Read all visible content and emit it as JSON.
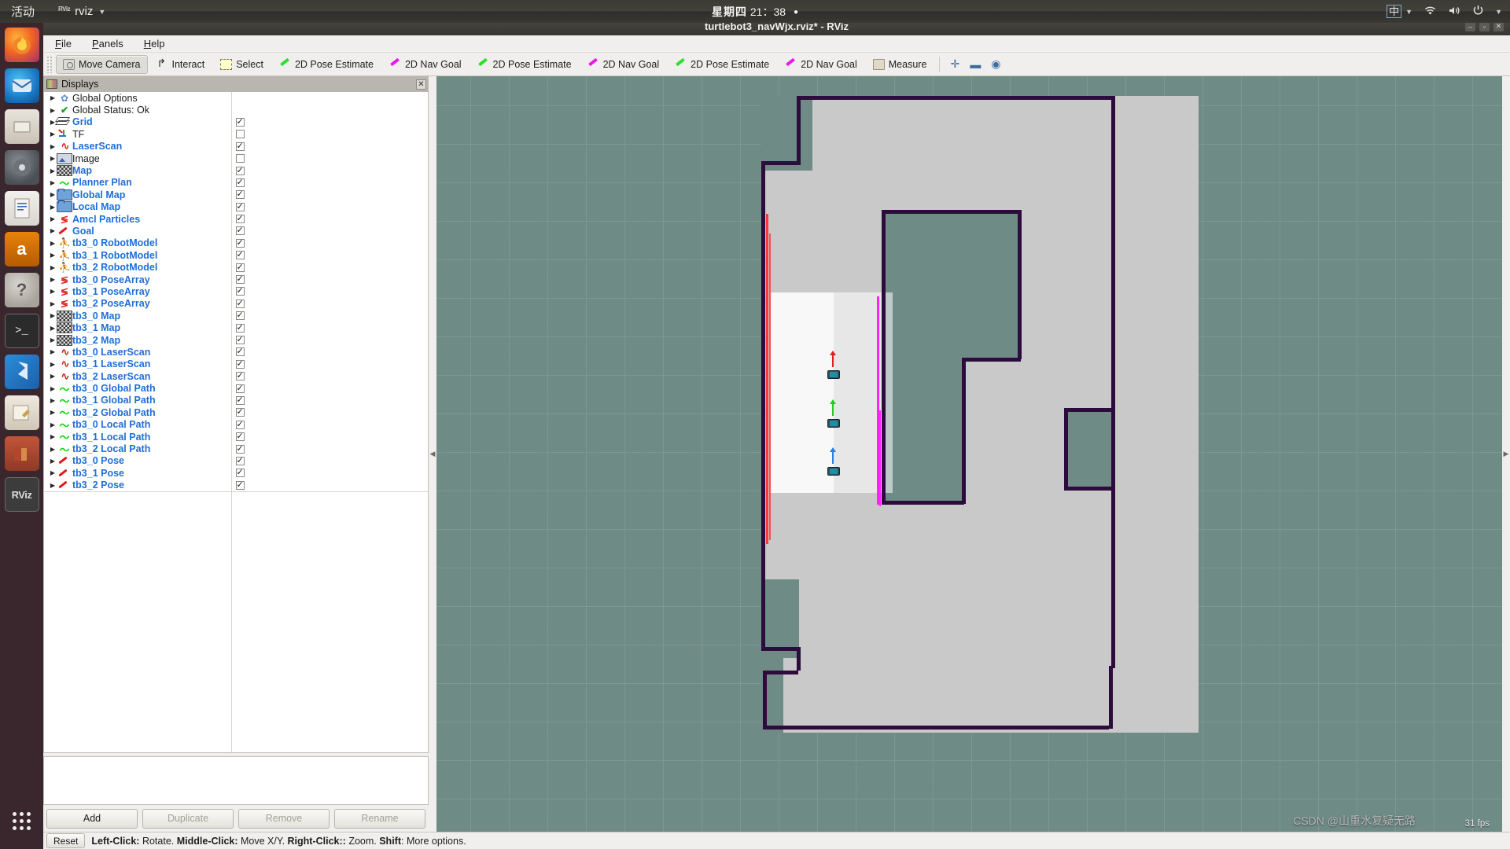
{
  "desktop": {
    "activities": "活动",
    "app_icon_text": "RViz",
    "app_name": "rviz",
    "caret": "▼",
    "clock_day": "星期四",
    "clock_time": "21：38",
    "clock_dot": "●",
    "tray": {
      "ime": "中",
      "ime_caret": "▼",
      "wifi_icon": "wifi-icon",
      "volume_icon": "volume-icon",
      "power_icon": "power-icon",
      "power_caret": "▼"
    },
    "launcher": [
      {
        "name": "firefox",
        "label": "Firefox",
        "glyph": "",
        "cls": "dock-firefox"
      },
      {
        "name": "thunderbird",
        "label": "Thunderbird",
        "glyph": "",
        "cls": "dock-thunderbird"
      },
      {
        "name": "files",
        "label": "Files",
        "glyph": "",
        "cls": "dock-files"
      },
      {
        "name": "rhythmbox",
        "label": "Rhythmbox",
        "glyph": "",
        "cls": "dock-rhythmbox"
      },
      {
        "name": "libreoffice-writer",
        "label": "LibreOffice Writer",
        "glyph": "",
        "cls": "dock-writer"
      },
      {
        "name": "amazon",
        "label": "Amazon",
        "glyph": "a",
        "cls": "dock-amazon"
      },
      {
        "name": "help",
        "label": "Help",
        "glyph": "?",
        "cls": "dock-help"
      },
      {
        "name": "terminal",
        "label": "Terminal",
        "glyph": ">_",
        "cls": "dock-term"
      },
      {
        "name": "vscode",
        "label": "Visual Studio Code",
        "glyph": "",
        "cls": "dock-vscode"
      },
      {
        "name": "text-editor",
        "label": "Text Editor",
        "glyph": "",
        "cls": "dock-editor"
      },
      {
        "name": "books",
        "label": "Books",
        "glyph": "",
        "cls": "dock-books"
      },
      {
        "name": "rviz",
        "label": "RViz",
        "glyph": "RViz",
        "cls": "dock-rviz"
      }
    ],
    "show_apps_label": "Show Applications"
  },
  "window": {
    "title": "turtlebot3_navWjx.rviz* - RViz",
    "minimize": "‒",
    "maximize": "▫",
    "close": "✕"
  },
  "menubar": [
    {
      "name": "menu-file",
      "label": "File",
      "mnemonic": "F",
      "rest": "ile"
    },
    {
      "name": "menu-panels",
      "label": "Panels",
      "mnemonic": "P",
      "rest": "anels"
    },
    {
      "name": "menu-help",
      "label": "Help",
      "mnemonic": "H",
      "rest": "elp"
    }
  ],
  "toolbar": {
    "buttons": [
      {
        "name": "tool-move-camera",
        "label": "Move Camera",
        "icon": "camera-icon",
        "icon_cls": "ti-camera",
        "active": true
      },
      {
        "name": "tool-interact",
        "label": "Interact",
        "icon": "cursor-icon",
        "icon_cls": "ti-interact",
        "active": false
      },
      {
        "name": "tool-select",
        "label": "Select",
        "icon": "selection-box-icon",
        "icon_cls": "ti-select",
        "active": false
      },
      {
        "name": "tool-2d-pose-estimate-1",
        "label": "2D Pose Estimate",
        "icon": "green-arrow-icon",
        "icon_cls": "ti-arrowg",
        "active": false
      },
      {
        "name": "tool-2d-nav-goal-1",
        "label": "2D Nav Goal",
        "icon": "magenta-arrow-icon",
        "icon_cls": "ti-arrowm",
        "active": false
      },
      {
        "name": "tool-2d-pose-estimate-2",
        "label": "2D Pose Estimate",
        "icon": "blue-arrow-icon",
        "icon_cls": "ti-arrowg",
        "active": false
      },
      {
        "name": "tool-2d-nav-goal-2",
        "label": "2D Nav Goal",
        "icon": "magenta-arrow-icon",
        "icon_cls": "ti-arrowm",
        "active": false
      },
      {
        "name": "tool-2d-pose-estimate-3",
        "label": "2D Pose Estimate",
        "icon": "green-arrow-icon",
        "icon_cls": "ti-arrowg",
        "active": false
      },
      {
        "name": "tool-2d-nav-goal-3",
        "label": "2D Nav Goal",
        "icon": "magenta-arrow-icon",
        "icon_cls": "ti-arrowm",
        "active": false
      },
      {
        "name": "tool-measure",
        "label": "Measure",
        "icon": "ruler-icon",
        "icon_cls": "ti-measure",
        "active": false
      }
    ],
    "extra_icons": [
      {
        "name": "add-tool-icon",
        "glyph": "✛"
      },
      {
        "name": "remove-tool-icon",
        "glyph": "▬"
      },
      {
        "name": "tool-properties-icon",
        "glyph": "◉"
      }
    ]
  },
  "displays_panel": {
    "title": "Displays",
    "close_glyph": "✕",
    "tree": [
      {
        "label": "Global Options",
        "icon": "gear-icon",
        "icon_cls": "ic-gear",
        "enabled": false,
        "checkbox": null
      },
      {
        "label": "Global Status: Ok",
        "icon": "status-ok-icon",
        "icon_cls": "ic-check",
        "enabled": false,
        "checkbox": null
      },
      {
        "label": "Grid",
        "icon": "grid-icon",
        "icon_cls": "ic-grid",
        "enabled": true,
        "checkbox": true
      },
      {
        "label": "TF",
        "icon": "tf-axes-icon",
        "icon_cls": "ic-tf",
        "enabled": false,
        "checkbox": false
      },
      {
        "label": "LaserScan",
        "icon": "laserscan-icon",
        "icon_cls": "ic-laser",
        "enabled": true,
        "checkbox": true
      },
      {
        "label": "Image",
        "icon": "image-icon",
        "icon_cls": "ic-image",
        "enabled": false,
        "checkbox": false
      },
      {
        "label": "Map",
        "icon": "map-icon",
        "icon_cls": "ic-map",
        "enabled": true,
        "checkbox": true
      },
      {
        "label": "Planner Plan",
        "icon": "path-icon",
        "icon_cls": "ic-path",
        "enabled": true,
        "checkbox": true
      },
      {
        "label": "Global Map",
        "icon": "folder-icon",
        "icon_cls": "ic-folder",
        "enabled": true,
        "checkbox": true
      },
      {
        "label": "Local Map",
        "icon": "folder-icon",
        "icon_cls": "ic-folder",
        "enabled": true,
        "checkbox": true
      },
      {
        "label": "Amcl Particles",
        "icon": "posearray-icon",
        "icon_cls": "ic-poses",
        "enabled": true,
        "checkbox": true
      },
      {
        "label": "Goal",
        "icon": "goal-pose-icon",
        "icon_cls": "ic-goal",
        "enabled": true,
        "checkbox": true
      },
      {
        "label": "tb3_0 RobotModel",
        "icon": "robot-model-icon",
        "icon_cls": "ic-robot",
        "enabled": true,
        "checkbox": true
      },
      {
        "label": "tb3_1 RobotModel",
        "icon": "robot-model-icon",
        "icon_cls": "ic-robot",
        "enabled": true,
        "checkbox": true
      },
      {
        "label": "tb3_2 RobotModel",
        "icon": "robot-model-icon",
        "icon_cls": "ic-robot",
        "enabled": true,
        "checkbox": true
      },
      {
        "label": "tb3_0 PoseArray",
        "icon": "posearray-icon",
        "icon_cls": "ic-poses",
        "enabled": true,
        "checkbox": true
      },
      {
        "label": "tb3_1 PoseArray",
        "icon": "posearray-icon",
        "icon_cls": "ic-poses",
        "enabled": true,
        "checkbox": true
      },
      {
        "label": "tb3_2 PoseArray",
        "icon": "posearray-icon",
        "icon_cls": "ic-poses",
        "enabled": true,
        "checkbox": true
      },
      {
        "label": "tb3_0 Map",
        "icon": "map-icon",
        "icon_cls": "ic-map",
        "enabled": true,
        "checkbox": true
      },
      {
        "label": "tb3_1 Map",
        "icon": "map-icon",
        "icon_cls": "ic-map",
        "enabled": true,
        "checkbox": true
      },
      {
        "label": "tb3_2 Map",
        "icon": "map-icon",
        "icon_cls": "ic-map",
        "enabled": true,
        "checkbox": true
      },
      {
        "label": "tb3_0 LaserScan",
        "icon": "laserscan-icon",
        "icon_cls": "ic-laser",
        "enabled": true,
        "checkbox": true
      },
      {
        "label": "tb3_1 LaserScan",
        "icon": "laserscan-icon",
        "icon_cls": "ic-laser",
        "enabled": true,
        "checkbox": true
      },
      {
        "label": "tb3_2 LaserScan",
        "icon": "laserscan-icon",
        "icon_cls": "ic-laser",
        "enabled": true,
        "checkbox": true
      },
      {
        "label": "tb3_0 Global Path",
        "icon": "path-icon",
        "icon_cls": "ic-path",
        "enabled": true,
        "checkbox": true
      },
      {
        "label": "tb3_1 Global Path",
        "icon": "path-icon",
        "icon_cls": "ic-path",
        "enabled": true,
        "checkbox": true
      },
      {
        "label": "tb3_2 Global Path",
        "icon": "path-icon",
        "icon_cls": "ic-path",
        "enabled": true,
        "checkbox": true
      },
      {
        "label": "tb3_0 Local Path",
        "icon": "path-icon",
        "icon_cls": "ic-path",
        "enabled": true,
        "checkbox": true
      },
      {
        "label": "tb3_1 Local Path",
        "icon": "path-icon",
        "icon_cls": "ic-path",
        "enabled": true,
        "checkbox": true
      },
      {
        "label": "tb3_2 Local Path",
        "icon": "path-icon",
        "icon_cls": "ic-path",
        "enabled": true,
        "checkbox": true
      },
      {
        "label": "tb3_0 Pose",
        "icon": "goal-pose-icon",
        "icon_cls": "ic-goal",
        "enabled": true,
        "checkbox": true
      },
      {
        "label": "tb3_1 Pose",
        "icon": "goal-pose-icon",
        "icon_cls": "ic-goal",
        "enabled": true,
        "checkbox": true
      },
      {
        "label": "tb3_2 Pose",
        "icon": "goal-pose-icon",
        "icon_cls": "ic-goal",
        "enabled": true,
        "checkbox": true
      }
    ],
    "buttons": [
      {
        "name": "add-display-button",
        "label": "Add",
        "disabled": false
      },
      {
        "name": "duplicate-display-button",
        "label": "Duplicate",
        "disabled": true
      },
      {
        "name": "remove-display-button",
        "label": "Remove",
        "disabled": true
      },
      {
        "name": "rename-display-button",
        "label": "Rename",
        "disabled": true
      }
    ],
    "expand_arrow": "▶"
  },
  "viewport": {
    "fps": "31 fps",
    "watermark": "CSDN @山重水复疑无路",
    "splitter_left_glyph": "◀",
    "splitter_right_glyph": "▶"
  },
  "statusbar": {
    "reset_label": "Reset",
    "hint_parts": [
      {
        "text": "Left-Click:",
        "bold": true
      },
      {
        "text": " Rotate. ",
        "bold": false
      },
      {
        "text": "Middle-Click:",
        "bold": true
      },
      {
        "text": " Move X/Y. ",
        "bold": false
      },
      {
        "text": "Right-Click::",
        "bold": true
      },
      {
        "text": " Zoom. ",
        "bold": false
      },
      {
        "text": "Shift",
        "bold": true
      },
      {
        "text": ": More options.",
        "bold": false
      }
    ]
  }
}
